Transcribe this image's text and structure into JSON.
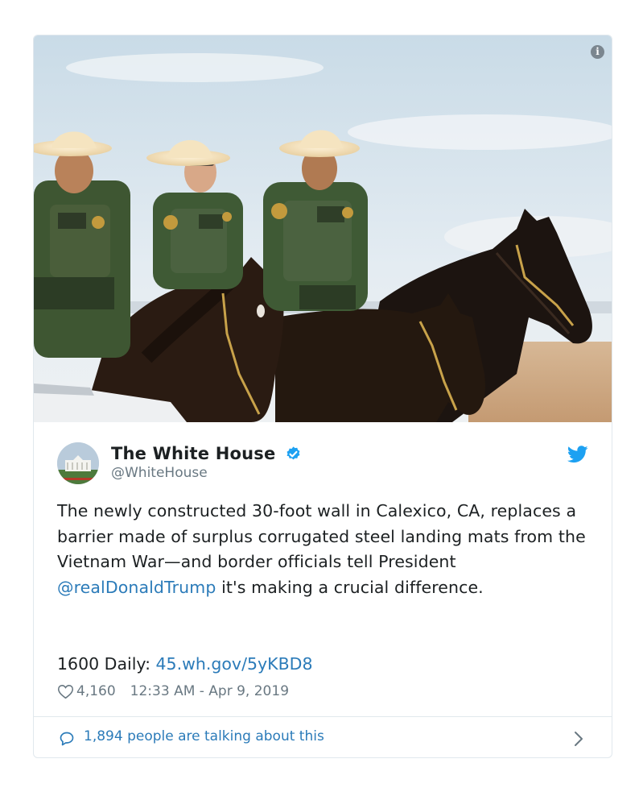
{
  "tweet": {
    "author_name": "The White House",
    "author_handle": "@WhiteHouse",
    "text_before_mention": "The newly constructed 30-foot wall in Calexico, CA, replaces a barrier made of surplus corrugated steel landing mats from the Vietnam War—and border officials tell President ",
    "mention": "@realDonaldTrump",
    "text_after_mention": " it's making a crucial difference.",
    "daily_label": "1600 Daily: ",
    "daily_link": "45.wh.gov/5yKBD8",
    "likes": "4,160",
    "timestamp": "12:33 AM - Apr 9, 2019",
    "talking": "1,894 people are talking about this"
  },
  "icons": {
    "info": "info-icon",
    "verified": "verified-badge-icon",
    "twitter": "twitter-bird-icon",
    "heart": "heart-icon",
    "comment": "speech-bubble-icon",
    "chevron": "chevron-right-icon"
  },
  "colors": {
    "link": "#2b7bb9",
    "twitter_blue": "#1da1f2",
    "muted": "#697882",
    "text": "#1c2022",
    "border": "#e1e8ed"
  }
}
